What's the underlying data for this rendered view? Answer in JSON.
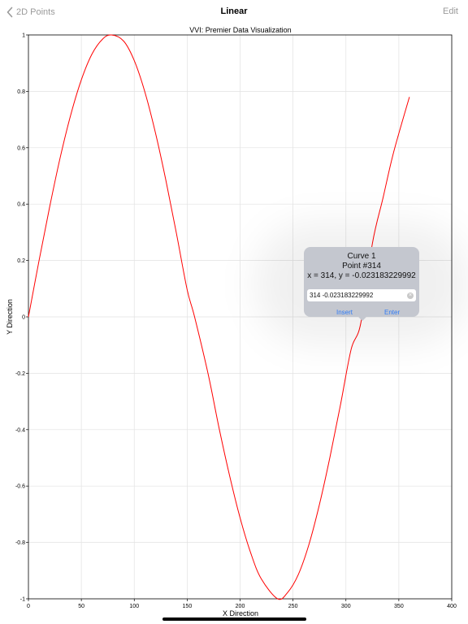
{
  "nav": {
    "back_label": "2D Points",
    "title": "Linear",
    "edit_label": "Edit",
    "accent_color": "#9a9a9a"
  },
  "chart_data": {
    "type": "line",
    "title": "VVI: Premier Data Visualization",
    "xlabel": "X Direction",
    "ylabel": "Y Direction",
    "xlim": [
      0,
      400
    ],
    "ylim": [
      -1,
      1
    ],
    "x_ticks": [
      0,
      50,
      100,
      150,
      200,
      250,
      300,
      350,
      400
    ],
    "x_tick_labels": [
      "0",
      "50",
      "100",
      "150",
      "200",
      "250",
      "300",
      "350",
      "400"
    ],
    "y_ticks": [
      1,
      0.8,
      0.6,
      0.4,
      0.2,
      0,
      -0.2,
      -0.4,
      -0.6,
      -0.8,
      -1
    ],
    "y_tick_labels": [
      "1",
      "0.8",
      "0.6",
      "0.4",
      "0.2",
      "0",
      "-0.2",
      "-0.4",
      "-0.6",
      "-0.8",
      "-1"
    ],
    "grid": true,
    "series": [
      {
        "color": "#ff0000",
        "x": [
          0,
          10,
          20,
          30,
          40,
          50,
          60,
          70,
          78.5,
          90,
          100,
          110,
          120,
          130,
          140,
          150,
          157,
          170,
          180,
          190,
          200,
          210,
          220,
          235.5,
          245,
          255,
          265,
          275,
          285,
          295,
          305,
          314,
          325,
          335,
          345,
          360
        ],
        "y": [
          0,
          0.199,
          0.389,
          0.565,
          0.717,
          0.841,
          0.932,
          0.985,
          1,
          0.978,
          0.909,
          0.798,
          0.653,
          0.482,
          0.293,
          0.096,
          0,
          -0.206,
          -0.392,
          -0.562,
          -0.713,
          -0.837,
          -0.929,
          -1,
          -0.977,
          -0.914,
          -0.808,
          -0.665,
          -0.496,
          -0.309,
          -0.114,
          -0.023,
          0.26,
          0.421,
          0.583,
          0.78
        ]
      }
    ]
  },
  "popover": {
    "curve": "Curve 1",
    "point": "Point #314",
    "coords": "x = 314, y = -0.023183229992",
    "input_value": "314 -0.023183229992",
    "insert_label": "Insert",
    "enter_label": "Enter",
    "clear_icon": "clear-icon",
    "button_color": "#2f7bf5"
  }
}
